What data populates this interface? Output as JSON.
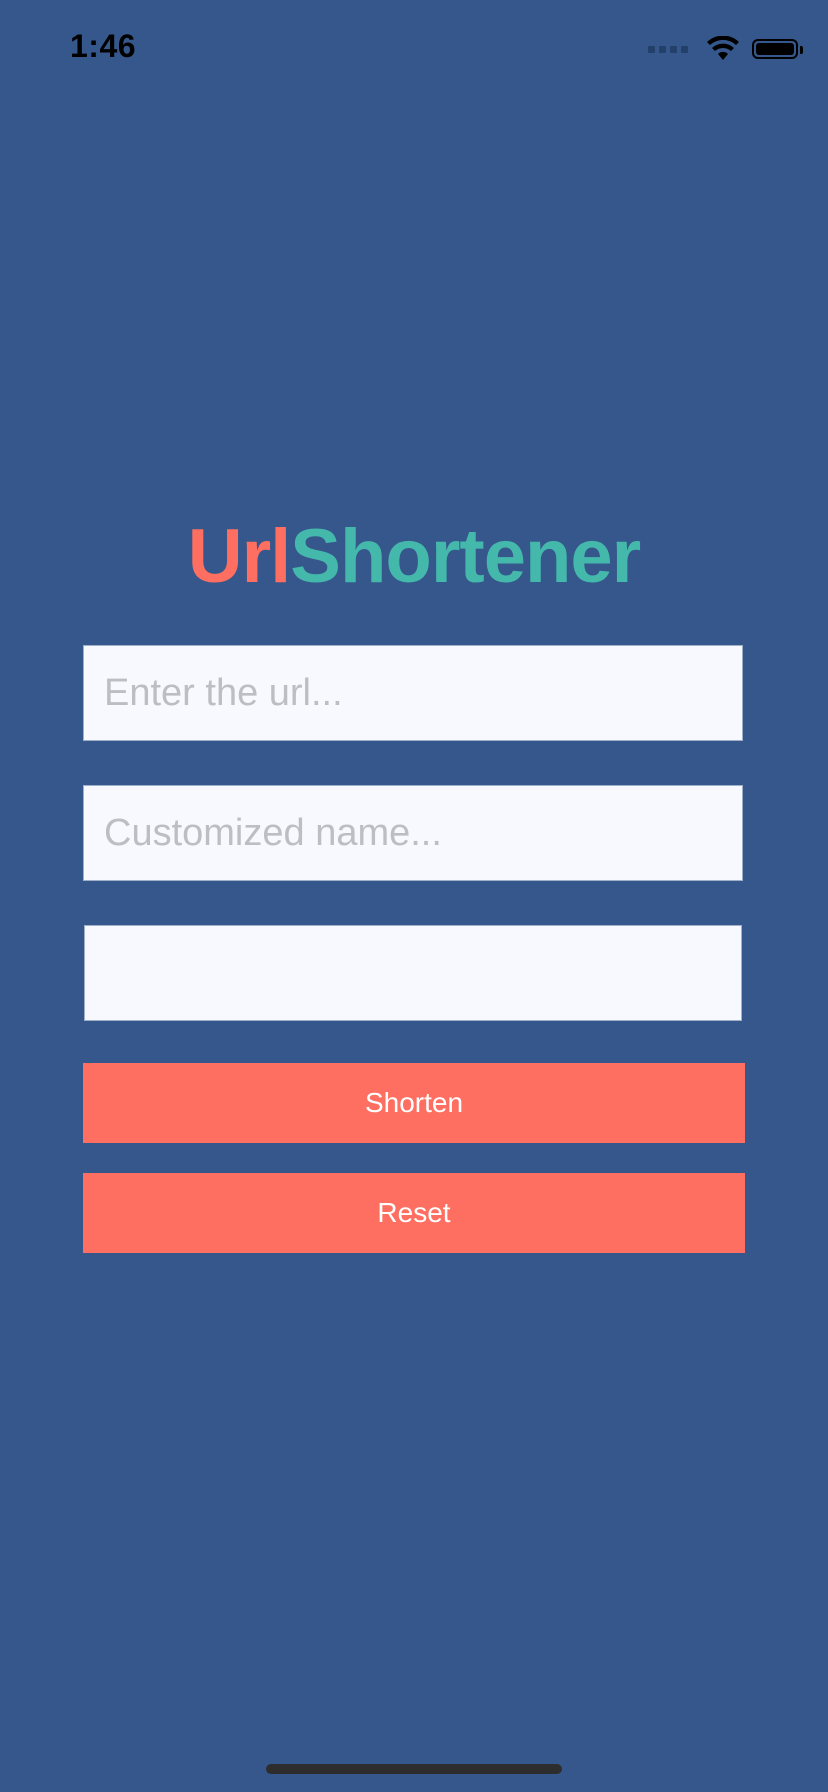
{
  "status_bar": {
    "time": "1:46",
    "icons": [
      "cellular-signal-icon",
      "wifi-icon",
      "battery-icon"
    ]
  },
  "app": {
    "title_part1": "Url",
    "title_part2": "Shortener"
  },
  "form": {
    "url_placeholder": "Enter the url...",
    "url_value": "",
    "custom_name_placeholder": "Customized name...",
    "custom_name_value": "",
    "result_value": "",
    "shorten_label": "Shorten",
    "reset_label": "Reset"
  },
  "colors": {
    "background": "#35578B",
    "accent_coral": "#FF6F61",
    "accent_teal": "#45B8AC",
    "field_background": "#F7F9FF"
  }
}
